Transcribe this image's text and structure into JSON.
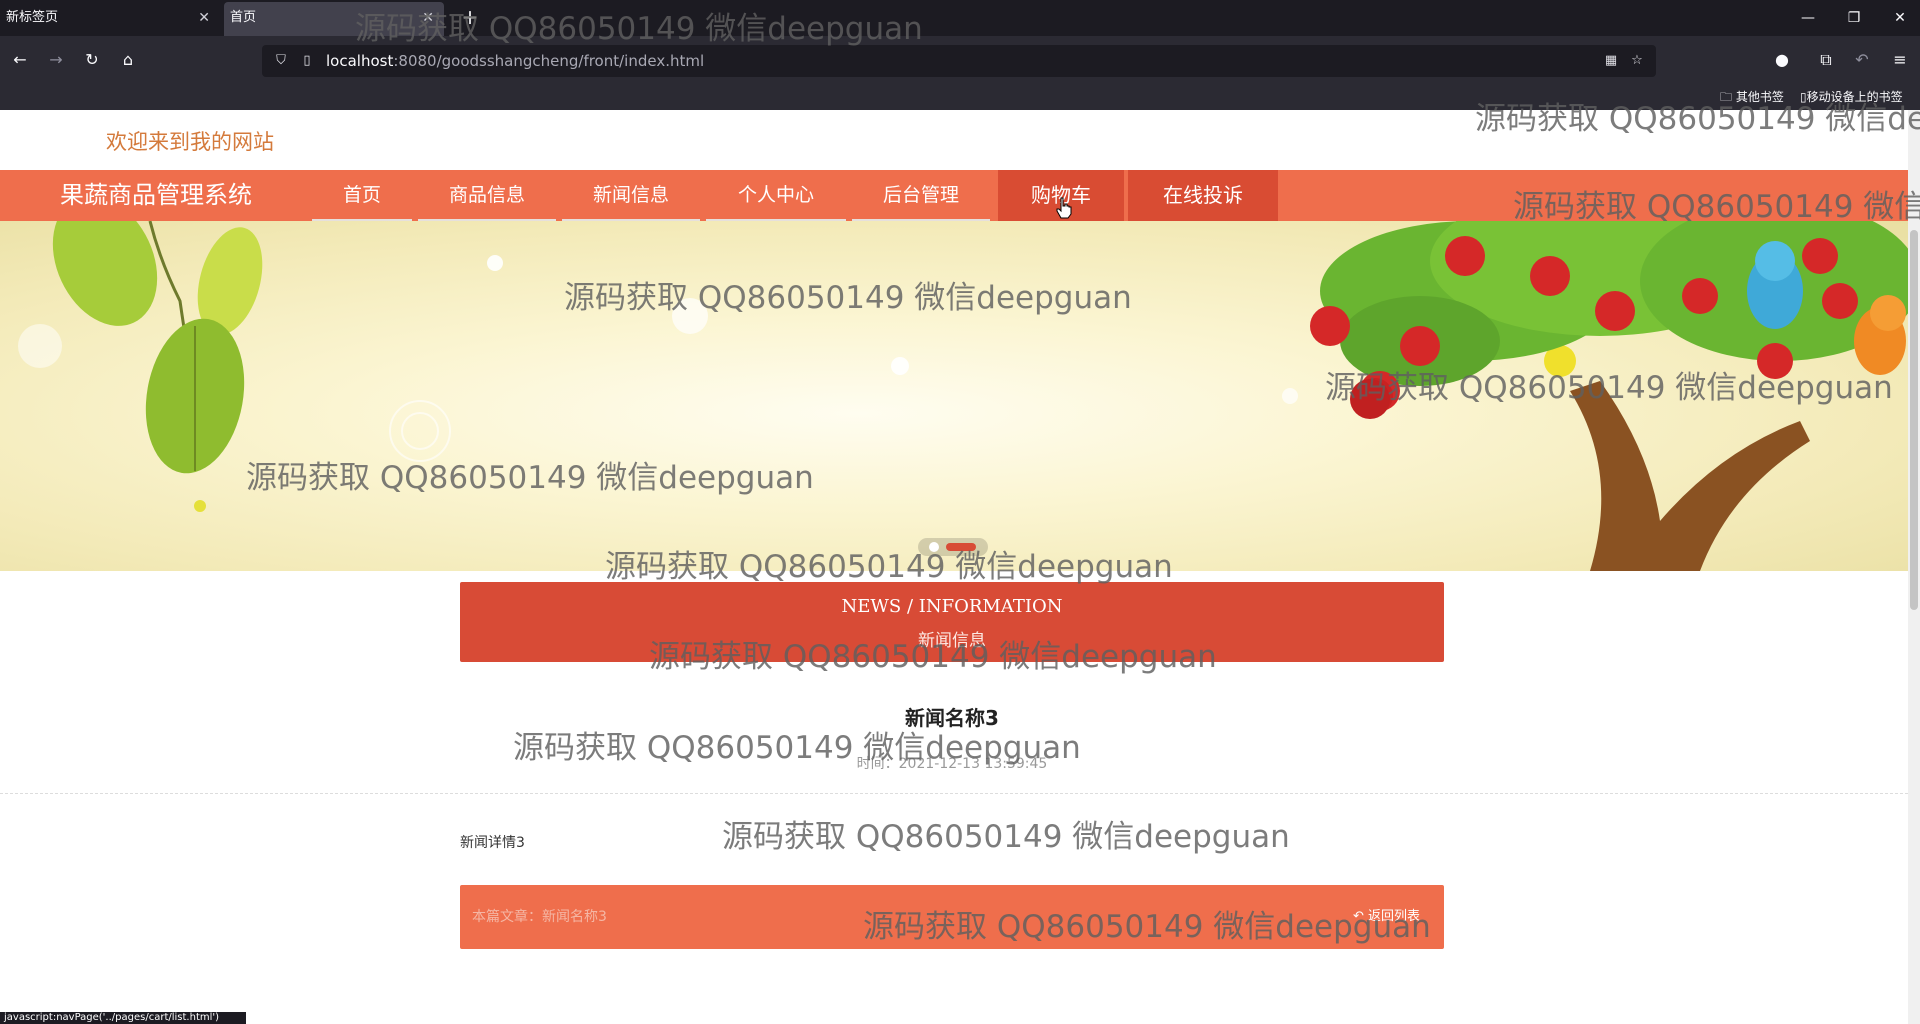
{
  "browser": {
    "tabs": [
      {
        "title": "新标签页"
      },
      {
        "title": "首页"
      }
    ],
    "url_host": "localhost",
    "url_rest": ":8080/goodsshangcheng/front/index.html",
    "bookmarks": [
      "其他书签",
      "移动设备上的书签"
    ],
    "status_text": "javascript:navPage('../pages/cart/list.html')"
  },
  "site": {
    "welcome": "欢迎来到我的网站",
    "brand": "果蔬商品管理系统",
    "nav": [
      "首页",
      "商品信息",
      "新闻信息",
      "个人中心",
      "后台管理",
      "购物车",
      "在线投诉"
    ],
    "active_nav": "购物车",
    "accent_color": "#ef6e4c"
  },
  "news": {
    "header_en": "NEWS / INFORMATION",
    "header_cn": "新闻信息",
    "title": "新闻名称3",
    "time": "时间：2021-12-13 13:59:45",
    "detail": "新闻详情3",
    "recommend": "本篇文章：新闻名称3",
    "back_label": "返回列表"
  },
  "watermark": "源码获取 QQ86050149 微信deepguan"
}
